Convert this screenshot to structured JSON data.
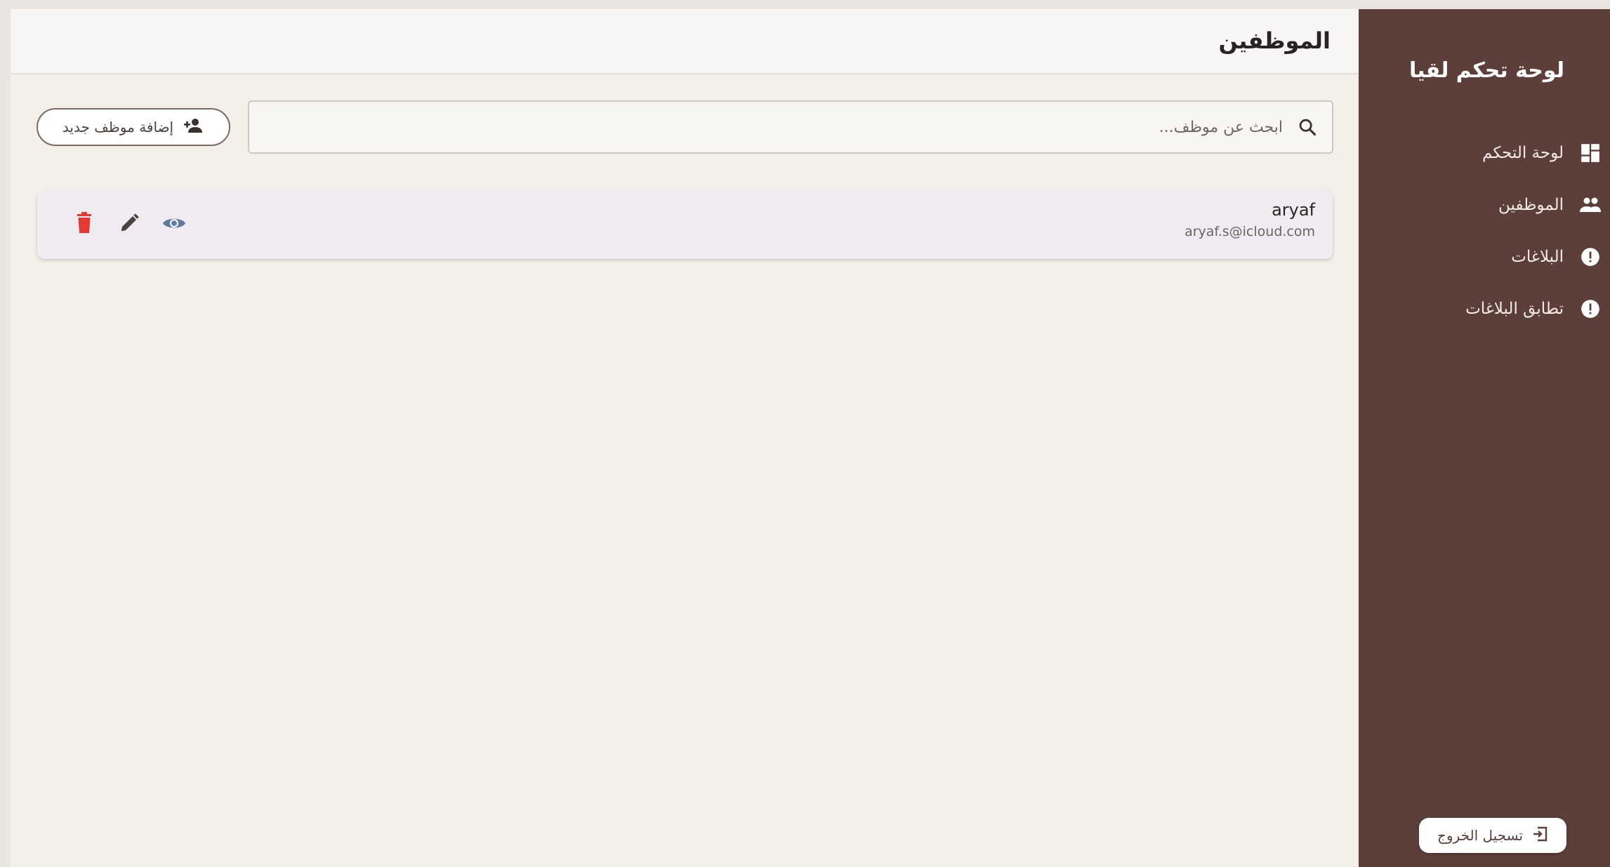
{
  "sidebar": {
    "title": "لوحة تحكم لقيا",
    "items": [
      {
        "label": "لوحة التحكم",
        "icon": "dashboard-icon"
      },
      {
        "label": "الموظفين",
        "icon": "people-icon"
      },
      {
        "label": "البلاغات",
        "icon": "alert-circle-icon"
      },
      {
        "label": "تطابق البلاغات",
        "icon": "alert-circle-icon"
      }
    ],
    "logout_label": "تسجيل الخروج"
  },
  "header": {
    "title": "الموظفين"
  },
  "search": {
    "placeholder": "ابحث عن موظف..."
  },
  "toolbar": {
    "add_label": "إضافة موظف جديد"
  },
  "employees": [
    {
      "name": "aryaf",
      "email": "aryaf.s@icloud.com"
    }
  ],
  "colors": {
    "sidebar_bg": "#5b3f38",
    "page_bg": "#f4efe9",
    "delete": "#e53935",
    "view": "#5b7d99",
    "edit": "#4a403b"
  }
}
